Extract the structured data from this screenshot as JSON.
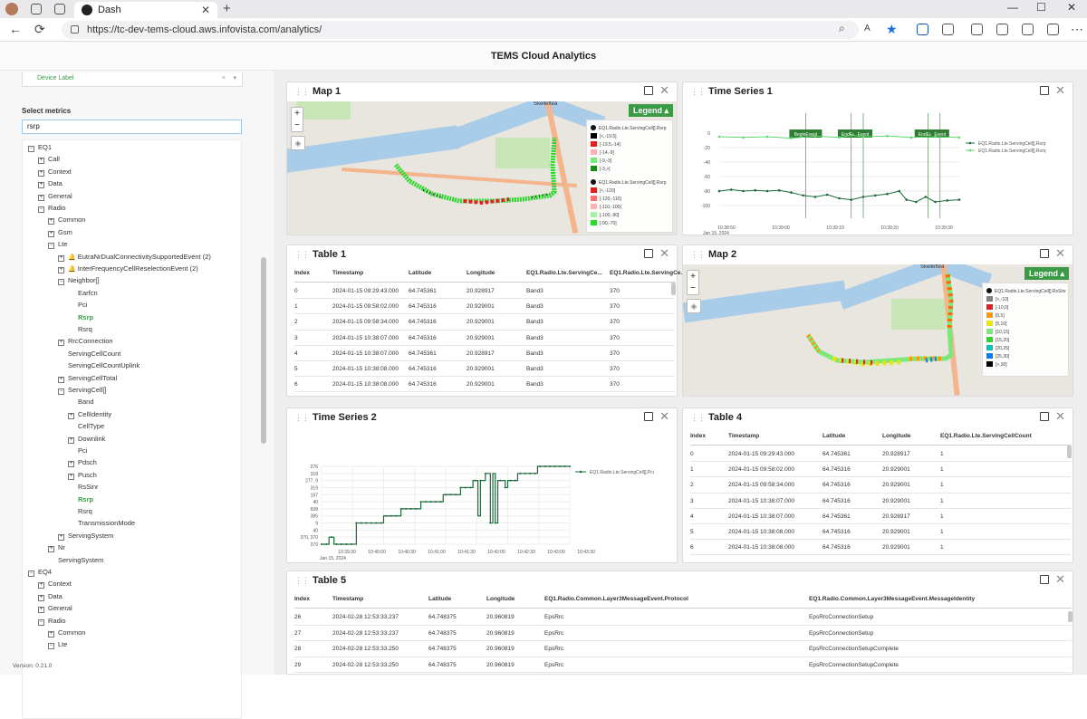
{
  "browser": {
    "tab_title": "Dash",
    "url": "https://tc-dev-tems-cloud.aws.infovista.com/analytics/"
  },
  "app": {
    "title": "TEMS Cloud Analytics",
    "version": "Version: 0.21.0"
  },
  "sidebar": {
    "device_label": "Device Label",
    "select_metrics_label": "Select metrics",
    "search_value": "rsrp",
    "tree": [
      {
        "label": "EQ1",
        "level": 0,
        "box": "−"
      },
      {
        "label": "Call",
        "level": 1,
        "box": "+"
      },
      {
        "label": "Context",
        "level": 1,
        "box": "+"
      },
      {
        "label": "Data",
        "level": 1,
        "box": "+"
      },
      {
        "label": "General",
        "level": 1,
        "box": "+"
      },
      {
        "label": "Radio",
        "level": 1,
        "box": "−"
      },
      {
        "label": "Common",
        "level": 2,
        "box": "+"
      },
      {
        "label": "Gsm",
        "level": 2,
        "box": "+"
      },
      {
        "label": "Lte",
        "level": 2,
        "box": "−"
      },
      {
        "label": "EutraNrDualConnectivitySupportedEvent (2)",
        "level": 3,
        "box": "+",
        "bell": true
      },
      {
        "label": "InterFrequencyCellReselectionEvent (2)",
        "level": 3,
        "box": "+",
        "bell": true
      },
      {
        "label": "Neighbor[]",
        "level": 3,
        "box": "−"
      },
      {
        "label": "Earfcn",
        "level": 4,
        "box": ""
      },
      {
        "label": "Pci",
        "level": 4,
        "box": ""
      },
      {
        "label": "Rsrp",
        "level": 4,
        "box": "",
        "green": true
      },
      {
        "label": "Rsrq",
        "level": 4,
        "box": ""
      },
      {
        "label": "RrcConnection",
        "level": 3,
        "box": "+"
      },
      {
        "label": "ServingCellCount",
        "level": 3,
        "box": ""
      },
      {
        "label": "ServingCellCountUplink",
        "level": 3,
        "box": ""
      },
      {
        "label": "ServingCellTotal",
        "level": 3,
        "box": "+"
      },
      {
        "label": "ServingCell[]",
        "level": 3,
        "box": "−"
      },
      {
        "label": "Band",
        "level": 4,
        "box": ""
      },
      {
        "label": "CellIdentity",
        "level": 4,
        "box": "+"
      },
      {
        "label": "CellType",
        "level": 4,
        "box": ""
      },
      {
        "label": "Downlink",
        "level": 4,
        "box": "+"
      },
      {
        "label": "Pci",
        "level": 4,
        "box": ""
      },
      {
        "label": "Pdsch",
        "level": 4,
        "box": "+"
      },
      {
        "label": "Pusch",
        "level": 4,
        "box": "+"
      },
      {
        "label": "RsSinr",
        "level": 4,
        "box": ""
      },
      {
        "label": "Rsrp",
        "level": 4,
        "box": "",
        "green": true
      },
      {
        "label": "Rsrq",
        "level": 4,
        "box": ""
      },
      {
        "label": "TransmissionMode",
        "level": 4,
        "box": ""
      },
      {
        "label": "ServingSystem",
        "level": 3,
        "box": "+"
      },
      {
        "label": "Nr",
        "level": 2,
        "box": "+"
      },
      {
        "label": "ServingSystem",
        "level": 2,
        "box": ""
      },
      {
        "label": "EQ4",
        "level": 0,
        "box": "−"
      },
      {
        "label": "Context",
        "level": 1,
        "box": "+"
      },
      {
        "label": "Data",
        "level": 1,
        "box": "+"
      },
      {
        "label": "General",
        "level": 1,
        "box": "+"
      },
      {
        "label": "Radio",
        "level": 1,
        "box": "−"
      },
      {
        "label": "Common",
        "level": 2,
        "box": "+"
      },
      {
        "label": "Lte",
        "level": 2,
        "box": "−"
      }
    ]
  },
  "panels": {
    "map1": {
      "title": "Map 1",
      "legend_button": "Legend ▴",
      "place_skelleftea": "Skellefteå",
      "legend_rsrp_title": "EQ1.Radio.Lte.ServingCell[].Rsrp",
      "legend_rsrp": [
        {
          "label": "[<,-19.5]",
          "color": "#000000"
        },
        {
          "label": "[-19.5,-14]",
          "color": "#e02020"
        },
        {
          "label": "[-14,-9]",
          "color": "#ffb0b0"
        },
        {
          "label": "[-9,-3]",
          "color": "#7ce87c"
        },
        {
          "label": "[-3,>]",
          "color": "#1c8a1c"
        }
      ],
      "legend_rsrq_title": "EQ1.Radio.Lte.ServingCell[].Rsrp",
      "legend_rsrq": [
        {
          "label": "[<,-120]",
          "color": "#e02020"
        },
        {
          "label": "[-120,-110]",
          "color": "#ff7070"
        },
        {
          "label": "[-110,-100]",
          "color": "#ffb0b0"
        },
        {
          "label": "[-100,-90]",
          "color": "#a8f0a8"
        },
        {
          "label": "[-90,-70]",
          "color": "#2bd82b"
        }
      ]
    },
    "ts1": {
      "title": "Time Series 1",
      "legend": [
        "EQ1.Radio.Lte.ServingCell[].Rsrp",
        "EQ1.Radio.Lte.ServingCell[].Rsrq"
      ],
      "events": [
        "BeginEvent",
        "EndEvent",
        "Event",
        "EndEvent",
        "Event"
      ],
      "date": "Jan 15, 2024"
    },
    "table1": {
      "title": "Table 1",
      "columns": [
        "Index",
        "Timestamp",
        "Latitude",
        "Longitude",
        "EQ1.Radio.Lte.ServingCe...",
        "EQ1.Radio.Lte.ServingCe..."
      ],
      "rows": [
        [
          "0",
          "2024-01-15 09:29:43.000",
          "64.745361",
          "20.928917",
          "Band3",
          "370"
        ],
        [
          "1",
          "2024-01-15 09:58:02.000",
          "64.745316",
          "20.929001",
          "Band3",
          "370"
        ],
        [
          "2",
          "2024-01-15 09:58:34.000",
          "64.745316",
          "20.929001",
          "Band3",
          "370"
        ],
        [
          "3",
          "2024-01-15 10:38:07.000",
          "64.745316",
          "20.929001",
          "Band3",
          "370"
        ],
        [
          "4",
          "2024-01-15 10:38:07.000",
          "64.745361",
          "20.928917",
          "Band3",
          "370"
        ],
        [
          "5",
          "2024-01-15 10:38:08.000",
          "64.745316",
          "20.929001",
          "Band3",
          "370"
        ],
        [
          "6",
          "2024-01-15 10:38:08.000",
          "64.745316",
          "20.929001",
          "Band3",
          "370"
        ]
      ]
    },
    "map2": {
      "title": "Map 2",
      "legend_button": "Legend ▴",
      "place_skelleftea": "Skellefteå",
      "legend_title": "EQ1.Radio.Lte.ServingCell[].RsSinr",
      "legend": [
        {
          "label": "[<,-10]",
          "color": "#808080"
        },
        {
          "label": "[-10,0]",
          "color": "#e02020"
        },
        {
          "label": "[0,5]",
          "color": "#ff9a00"
        },
        {
          "label": "[5,10]",
          "color": "#e8e800"
        },
        {
          "label": "[10,15]",
          "color": "#7ce87c"
        },
        {
          "label": "[15,20]",
          "color": "#2bd82b"
        },
        {
          "label": "[20,25]",
          "color": "#00c0c0"
        },
        {
          "label": "[25,30]",
          "color": "#0080ff"
        },
        {
          "label": "[>,30]",
          "color": "#000000"
        }
      ]
    },
    "ts2": {
      "title": "Time Series 2",
      "legend": "EQ1.Radio.Lte.ServingCell[].Pci",
      "date": "Jan 15, 2024"
    },
    "table4": {
      "title": "Table 4",
      "columns": [
        "Index",
        "Timestamp",
        "Latitude",
        "Longitude",
        "EQ1.Radio.Lte.ServingCellCount"
      ],
      "rows": [
        [
          "0",
          "2024-01-15 09:29:43.000",
          "64.745361",
          "20.928917",
          "1"
        ],
        [
          "1",
          "2024-01-15 09:58:02.000",
          "64.745316",
          "20.929001",
          "1"
        ],
        [
          "2",
          "2024-01-15 09:58:34.000",
          "64.745316",
          "20.929001",
          "1"
        ],
        [
          "3",
          "2024-01-15 10:38:07.000",
          "64.745316",
          "20.929001",
          "1"
        ],
        [
          "4",
          "2024-01-15 10:38:07.000",
          "64.745361",
          "20.928917",
          "1"
        ],
        [
          "5",
          "2024-01-15 10:38:08.000",
          "64.745316",
          "20.929001",
          "1"
        ],
        [
          "6",
          "2024-01-15 10:38:08.000",
          "64.745316",
          "20.929001",
          "1"
        ]
      ]
    },
    "table5": {
      "title": "Table 5",
      "columns": [
        "Index",
        "Timestamp",
        "Latitude",
        "Longitude",
        "EQ1.Radio.Common.Layer3MessageEvent.Protocol",
        "EQ1.Radio.Common.Layer3MessageEvent.MessageIdentity"
      ],
      "rows": [
        [
          "26",
          "2024-02-28 12:53:33.237",
          "64.748375",
          "20.960819",
          "EpsRrc",
          "EpsRrcConnectionSetup"
        ],
        [
          "27",
          "2024-02-28 12:53:33.237",
          "64.748375",
          "20.960819",
          "EpsRrc",
          "EpsRrcConnectionSetup"
        ],
        [
          "28",
          "2024-02-28 12:53:33.250",
          "64.748375",
          "20.960819",
          "EpsRrc",
          "EpsRrcConnectionSetupComplete"
        ],
        [
          "29",
          "2024-02-28 12:53:33.250",
          "64.748375",
          "20.960819",
          "EpsRrc",
          "EpsRrcConnectionSetupComplete"
        ]
      ]
    }
  },
  "chart_data": [
    {
      "type": "line",
      "title": "Time Series 1",
      "x": [
        "10:38:50",
        "10:39:00",
        "10:39:10",
        "10:39:20",
        "10:39:30"
      ],
      "yticks": [
        0,
        -20,
        -40,
        -60,
        -80,
        -100
      ],
      "ylim": [
        -105,
        5
      ],
      "series": [
        {
          "name": "EQ1.Radio.Lte.ServingCell[].Rsrp",
          "color": "#1c6b3a",
          "points": [
            [
              0,
              -80
            ],
            [
              0.05,
              -78
            ],
            [
              0.1,
              -80
            ],
            [
              0.15,
              -79
            ],
            [
              0.2,
              -80
            ],
            [
              0.25,
              -79
            ],
            [
              0.3,
              -82
            ],
            [
              0.35,
              -86
            ],
            [
              0.4,
              -88
            ],
            [
              0.45,
              -85
            ],
            [
              0.5,
              -90
            ],
            [
              0.55,
              -92
            ],
            [
              0.6,
              -88
            ],
            [
              0.65,
              -86
            ],
            [
              0.7,
              -84
            ],
            [
              0.75,
              -80
            ],
            [
              0.78,
              -92
            ],
            [
              0.82,
              -95
            ],
            [
              0.86,
              -88
            ],
            [
              0.9,
              -95
            ],
            [
              0.95,
              -93
            ],
            [
              1,
              -92
            ]
          ]
        },
        {
          "name": "EQ1.Radio.Lte.ServingCell[].Rsrq",
          "color": "#5fd96f",
          "points": [
            [
              0,
              -5
            ],
            [
              0.1,
              -6
            ],
            [
              0.2,
              -5
            ],
            [
              0.3,
              -7
            ],
            [
              0.4,
              -4
            ],
            [
              0.5,
              -6
            ],
            [
              0.55,
              -3
            ],
            [
              0.6,
              -5
            ],
            [
              0.7,
              -4
            ],
            [
              0.8,
              -6
            ],
            [
              0.9,
              -5
            ],
            [
              1,
              -6
            ]
          ]
        }
      ]
    },
    {
      "type": "line",
      "title": "Time Series 2",
      "x": [
        "10:39:30",
        "10:40:00",
        "10:40:30",
        "10:41:00",
        "10:41:30",
        "10:42:00",
        "10:42:30",
        "10:43:00",
        "10:43:30"
      ],
      "ytick_labels": [
        "276",
        "318",
        "277, 9",
        "319",
        "197",
        "40",
        "608",
        "385",
        "9",
        "40",
        "370, 370",
        "370"
      ],
      "series": [
        {
          "name": "EQ1.Radio.Lte.ServingCell[].Pci",
          "color": "#1c6b3a",
          "step_points": [
            [
              0,
              0
            ],
            [
              0.03,
              1
            ],
            [
              0.05,
              0
            ],
            [
              0.12,
              0
            ],
            [
              0.14,
              3
            ],
            [
              0.24,
              3
            ],
            [
              0.25,
              4
            ],
            [
              0.3,
              4
            ],
            [
              0.32,
              5
            ],
            [
              0.38,
              5
            ],
            [
              0.4,
              6
            ],
            [
              0.48,
              6
            ],
            [
              0.49,
              7
            ],
            [
              0.55,
              7
            ],
            [
              0.56,
              8
            ],
            [
              0.6,
              8
            ],
            [
              0.61,
              9
            ],
            [
              0.63,
              4
            ],
            [
              0.64,
              9
            ],
            [
              0.66,
              10
            ],
            [
              0.68,
              3
            ],
            [
              0.69,
              10
            ],
            [
              0.7,
              3
            ],
            [
              0.71,
              9
            ],
            [
              0.74,
              8
            ],
            [
              0.75,
              9
            ],
            [
              0.78,
              9
            ],
            [
              0.79,
              10
            ],
            [
              0.86,
              10
            ],
            [
              0.87,
              11
            ],
            [
              1,
              11
            ]
          ]
        }
      ]
    }
  ]
}
